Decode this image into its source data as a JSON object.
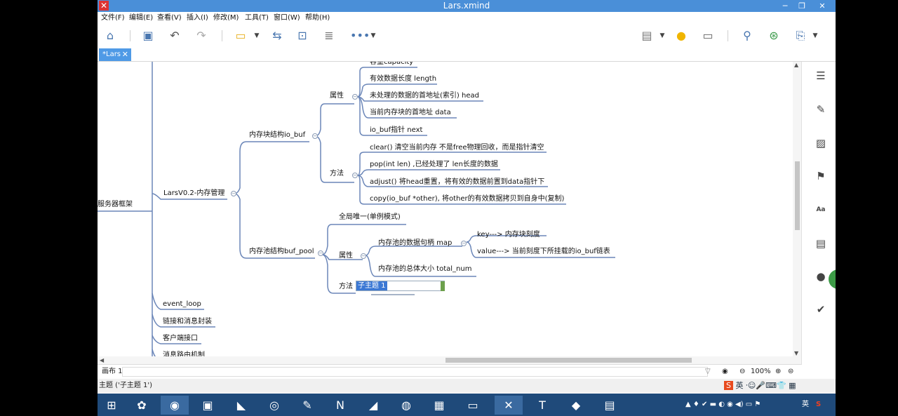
{
  "window": {
    "title": "Lars.xmind",
    "min": "─",
    "max": "❐",
    "close": "✕"
  },
  "menu": [
    "文件(F)",
    "编辑(E)",
    "查看(V)",
    "插入(I)",
    "修改(M)",
    "工具(T)",
    "窗口(W)",
    "帮助(H)"
  ],
  "tab": {
    "label": "*Lars",
    "close": "✕"
  },
  "mindmap": {
    "root": "服务器框架",
    "branch1": "LarsV0.2-内存管理",
    "io_buf": "内存块结构io_buf",
    "io_buf_attr": "属性",
    "io_buf_attrs": [
      "容量capacity",
      "有效数据长度 length",
      "未处理的数据的首地址(索引) head",
      "当前内存块的首地址 data",
      "io_buf指针 next"
    ],
    "io_buf_method": "方法",
    "io_buf_methods": [
      "clear() 清空当前内存 不是free物理回收，而是指针清空",
      "pop(int len) ,已经处理了 len长度的数据",
      "adjust() 将head重置，将有效的数据前置到data指针下",
      "copy(io_buf *other), 将other的有效数据拷贝到自身中(复制)"
    ],
    "buf_pool": "内存池结构buf_pool",
    "buf_pool_singleton": "全局唯一(单例模式)",
    "buf_pool_attr": "属性",
    "pool_map": "内存池的数据句柄 map",
    "map_key": "key---> 内存块刻度",
    "map_value": "value---> 当前刻度下所挂载的io_buf链表",
    "total_num": "内存池的总体大小 total_num",
    "buf_pool_method": "方法",
    "editing_topic": "子主题 1",
    "other_branches": [
      "event_loop",
      "链接和消息封装",
      "客户端接口",
      "消息路由机制"
    ]
  },
  "sheet": {
    "label": "画布 1",
    "zoom": "100%"
  },
  "status": {
    "text": "主题 ('子主题 1')",
    "ime": "英"
  },
  "taskbar": {
    "tray_lang": "英"
  },
  "colors": {
    "titlebar": "#4a8fd8",
    "tab": "#4f9ae6",
    "line": "#6b86b8",
    "taskbar": "#1f4a7a"
  }
}
